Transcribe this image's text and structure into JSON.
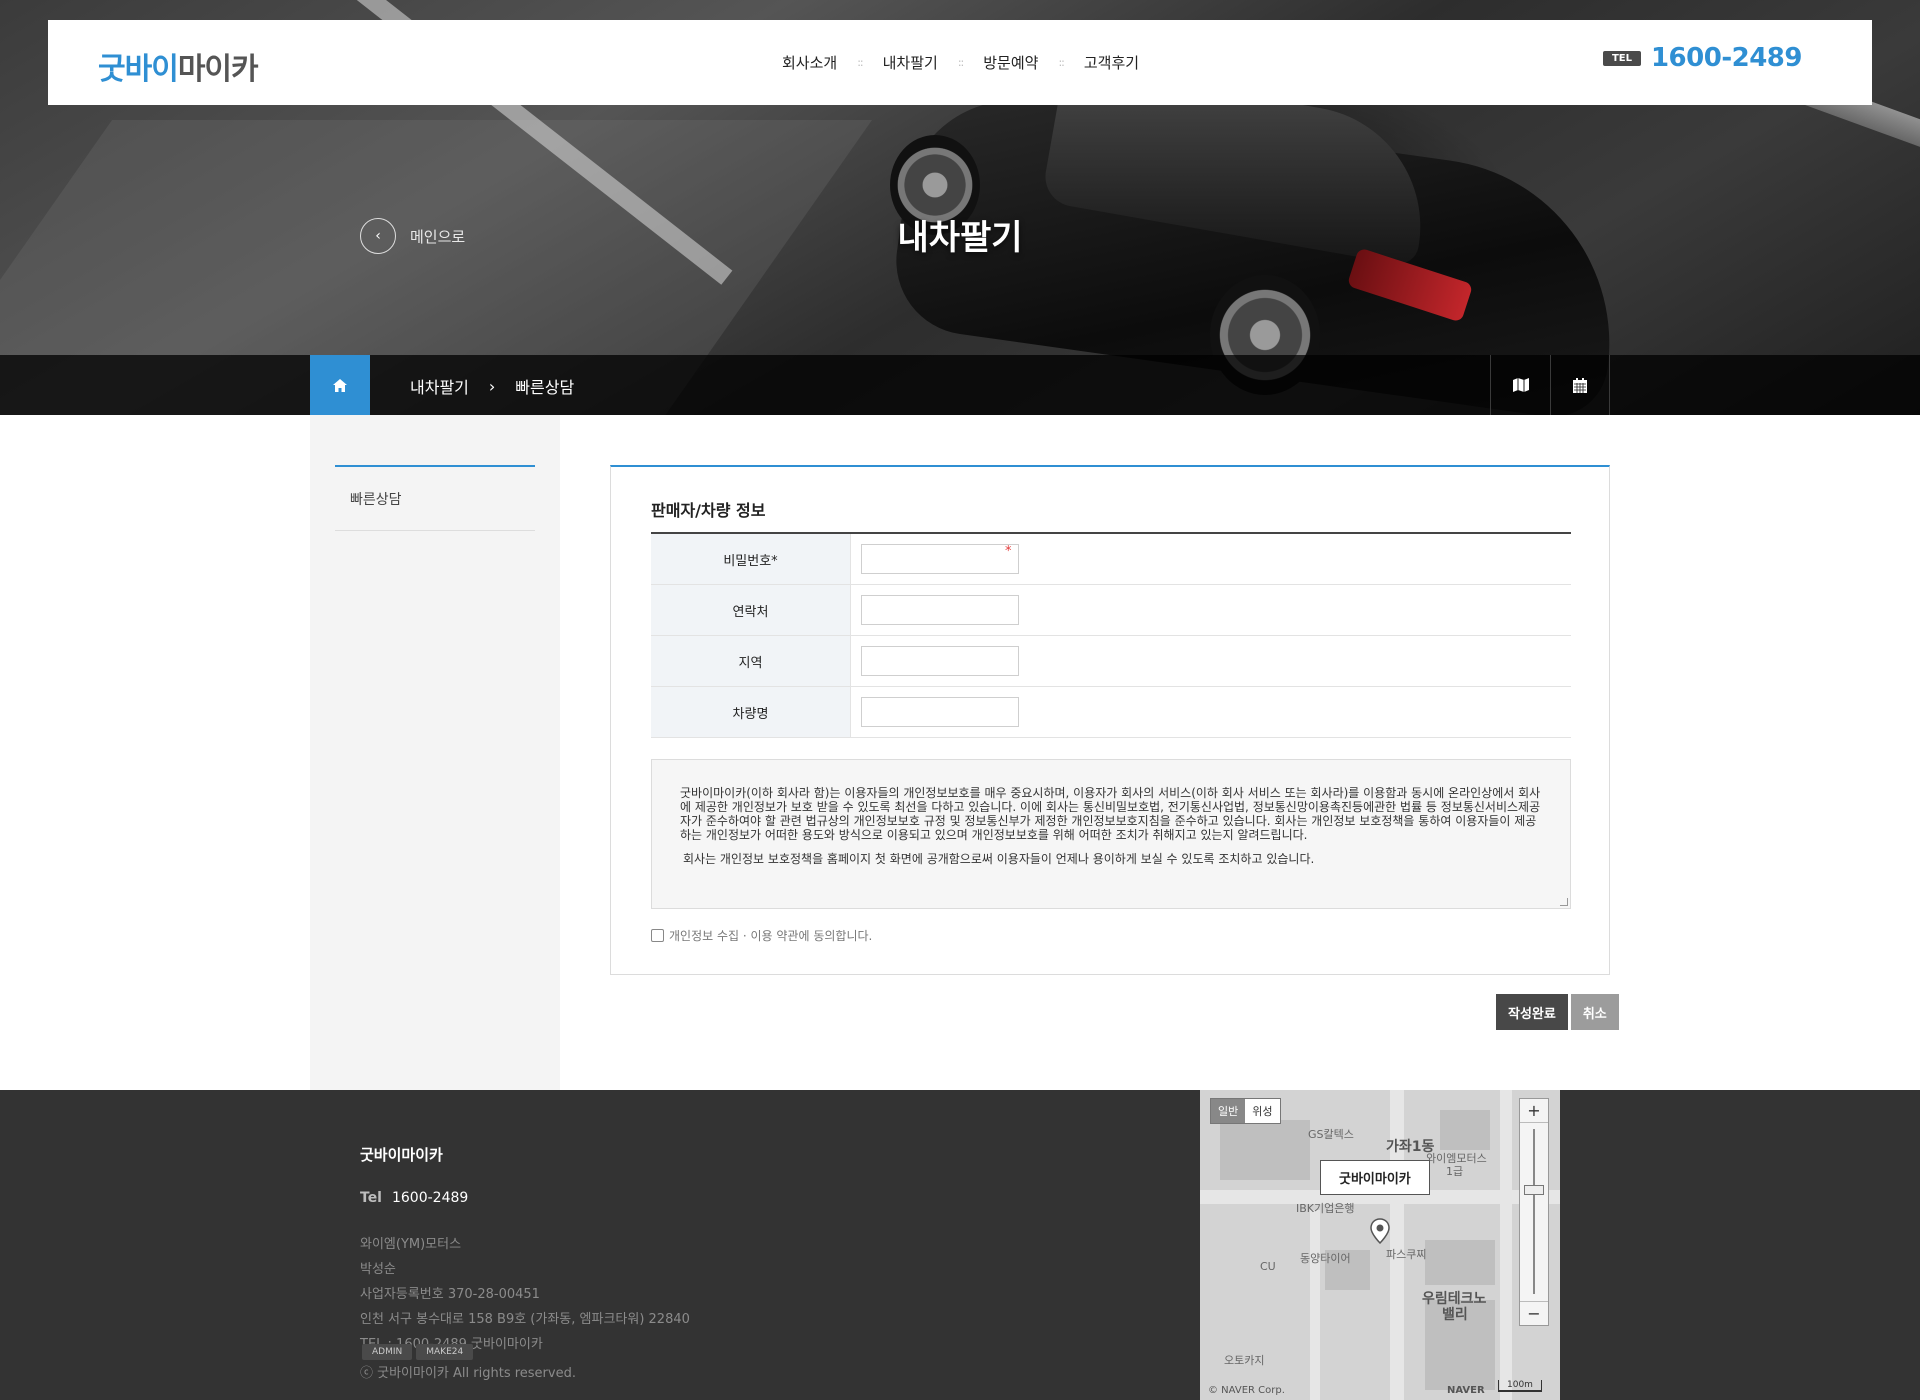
{
  "header": {
    "logo_part1": "굿바이",
    "logo_part2": "마이카",
    "nav": [
      "회사소개",
      "내차팔기",
      "방문예약",
      "고객후기"
    ],
    "tel_tag": "TEL",
    "tel_number": "1600-2489"
  },
  "hero": {
    "back_label": "메인으로",
    "title": "내차팔기"
  },
  "breadcrumb": {
    "items": [
      "내차팔기",
      "빠른상담"
    ],
    "tools": [
      "map-icon",
      "calendar-icon"
    ]
  },
  "sidebar": {
    "items": [
      "빠른상담"
    ]
  },
  "form": {
    "section_title": "판매자/차량 정보",
    "fields": [
      {
        "label": "비밀번호*",
        "value": "",
        "required_mark": "*"
      },
      {
        "label": "연락처",
        "value": ""
      },
      {
        "label": "지역",
        "value": ""
      },
      {
        "label": "차량명",
        "value": ""
      }
    ],
    "terms_paragraph1": "굿바이마이카(이하 회사라 함)는 이용자들의 개인정보보호를 매우 중요시하며, 이용자가 회사의 서비스(이하 회사 서비스 또는 회사라)를 이용함과 동시에 온라인상에서 회사에 제공한 개인정보가 보호 받을 수 있도록 최선을 다하고 있습니다. 이에 회사는 통신비밀보호법, 전기통신사업법, 정보통신망이용촉진등에관한 법률 등 정보통신서비스제공자가 준수하여야 할 관련 법규상의 개인정보보호 규정 및 정보통신부가 제정한 개인정보보호지침을 준수하고 있습니다. 회사는 개인정보 보호정책을 통하여 이용자들이 제공하는 개인정보가 어떠한 용도와 방식으로 이용되고 있으며 개인정보보호를 위해 어떠한 조치가 취해지고 있는지 알려드립니다.",
    "terms_paragraph2": "회사는 개인정보 보호정책을 홈페이지 첫 화면에 공개함으로써 이용자들이 언제나 용이하게 보실 수 있도록 조치하고 있습니다.",
    "agree_label": "개인정보 수집 · 이용 약관에 동의합니다.",
    "agree_checked": false,
    "submit_label": "작성완료",
    "cancel_label": "취소"
  },
  "footer": {
    "brand": "굿바이마이카",
    "tel_label": "Tel",
    "tel_value": "1600-2489",
    "info_lines": [
      "와이엠(YM)모터스",
      "박성순",
      "사업자등록번호 370-28-00451",
      "인천 서구 봉수대로 158 B9호 (가좌동, 엠파크타워) 22840",
      "TEL : 1600-2489 굿바이마이카"
    ],
    "admin_badges": [
      "ADMIN",
      "MAKE24"
    ],
    "copyright": "ⓒ 굿바이마이카 All rights reserved."
  },
  "map": {
    "toggle": [
      "일반",
      "위성"
    ],
    "active_toggle": "일반",
    "marker_label": "굿바이마이카",
    "labels": [
      "GS칼텍스",
      "가좌1동",
      "와이엠모터스",
      "1급",
      "IBK기업은행",
      "동양타이어",
      "파스쿠찌",
      "CU",
      "우림테크노",
      "밸리",
      "오토카지"
    ],
    "copyright": "© NAVER Corp.",
    "logo": "NAVER",
    "scale": "100m",
    "zoom_in": "+",
    "zoom_out": "−"
  }
}
